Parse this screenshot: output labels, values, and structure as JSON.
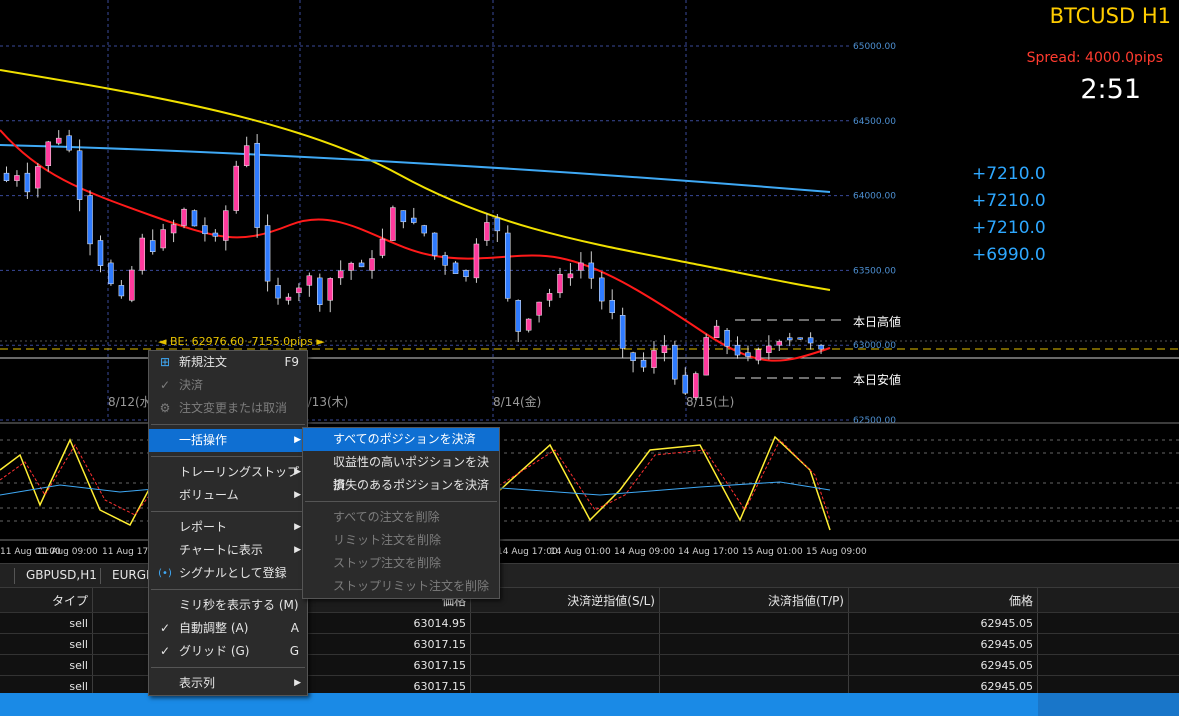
{
  "chart": {
    "title": "BTCUSD  H1",
    "spread": "Spread: 4000.0pips",
    "timer": "2:51",
    "profits": [
      "+7210.0",
      "+7210.0",
      "+7210.0",
      "+6990.0"
    ],
    "price_labels": [
      "65000.00",
      "64500.00",
      "64000.00",
      "63500.00",
      "63000.00",
      "62500.00"
    ],
    "date_labels": [
      "8/12(水)",
      "8/13(木)",
      "8/14(金)",
      "8/15(土)"
    ],
    "time_labels": [
      "11 Aug 01:00",
      "11 Aug 09:00",
      "11 Aug 17:00",
      "14 Aug 17:00",
      "14 Aug 01:00",
      "14 Aug 09:00",
      "14 Aug 17:00",
      "15 Aug 01:00",
      "15 Aug 09:00"
    ],
    "day_high_label": "本日高値",
    "day_low_label": "本日安値",
    "be_label": "◄ BE: 62976.60  -7155.0pips ►"
  },
  "tabs": [
    "GBPUSD,H1",
    "EURGB"
  ],
  "table": {
    "headers": [
      "タイプ",
      "価格",
      "決済逆指値(S/L)",
      "決済指値(T/P)",
      "価格"
    ],
    "rows": [
      {
        "type": "sell",
        "price": "63014.95",
        "close": "62945.05"
      },
      {
        "type": "sell",
        "price": "63017.15",
        "close": "62945.05"
      },
      {
        "type": "sell",
        "price": "63017.15",
        "close": "62945.05"
      },
      {
        "type": "sell",
        "price": "63017.15",
        "close": "62945.05"
      }
    ]
  },
  "context_menu": {
    "new_order": "新規注文",
    "new_order_shortcut": "F9",
    "close": "決済",
    "modify": "注文変更または取消",
    "bulk": "一括操作",
    "trailing_stop": "トレーリングストップ",
    "volume": "ボリューム",
    "report": "レポート",
    "show_on_chart": "チャートに表示",
    "register_signal": "シグナルとして登録",
    "show_ms": "ミリ秒を表示する (M)",
    "auto_arrange": "自動調整 (A)",
    "auto_arrange_shortcut": "A",
    "grid": "グリッド (G)",
    "grid_shortcut": "G",
    "columns": "表示列"
  },
  "submenu": {
    "close_all": "すべてのポジションを決済",
    "close_profitable": "収益性の高いポジションを決済",
    "close_losing": "損失のあるポジションを決済",
    "delete_all_orders": "すべての注文を削除",
    "delete_limit": "リミット注文を削除",
    "delete_stop": "ストップ注文を削除",
    "delete_stop_limit": "ストップリミット注文を削除"
  },
  "colors": {
    "bull": "#ff3a9d",
    "bear": "#2f7bff",
    "ma_yellow": "#f0e000",
    "ma_red": "#ff1a1a",
    "ma_blue": "#3fa9f5",
    "grid": "#3a4a9a",
    "accent": "#0f6fd2"
  }
}
